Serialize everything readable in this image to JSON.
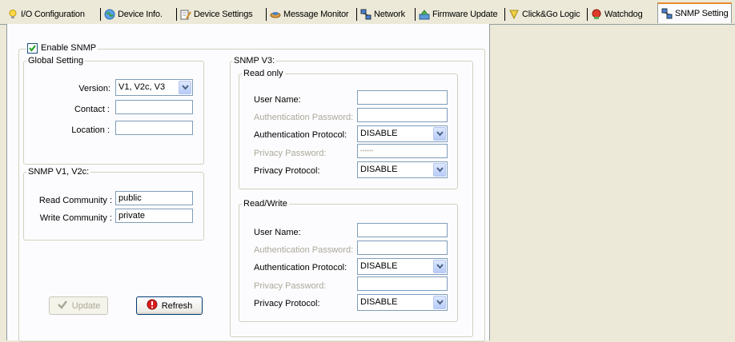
{
  "tabs": [
    {
      "label": "I/O Configuration",
      "icon": "lightbulb-icon"
    },
    {
      "label": "Device Info.",
      "icon": "globe-icon"
    },
    {
      "label": "Device Settings",
      "icon": "device-settings-icon"
    },
    {
      "label": "Message Monitor",
      "icon": "message-icon"
    },
    {
      "label": "Network",
      "icon": "network-icon"
    },
    {
      "label": "Firmware Update",
      "icon": "firmware-icon"
    },
    {
      "label": "Click&Go Logic",
      "icon": "logic-icon"
    },
    {
      "label": "Watchdog",
      "icon": "watchdog-icon"
    },
    {
      "label": "SNMP Setting",
      "icon": "snmp-icon"
    }
  ],
  "active_tab": "SNMP Setting",
  "enable_snmp": {
    "label": "Enable SNMP",
    "checked": true
  },
  "global": {
    "legend": "Global Setting",
    "version_label": "Version:",
    "version_value": "V1, V2c, V3",
    "contact_label": "Contact :",
    "contact_value": "",
    "location_label": "Location :",
    "location_value": ""
  },
  "v1v2c": {
    "legend": "SNMP V1, V2c:",
    "read_label": "Read Community :",
    "read_value": "public",
    "write_label": "Write Community :",
    "write_value": "private"
  },
  "v3": {
    "legend": "SNMP V3:",
    "read_only": {
      "legend": "Read only",
      "user_label": "User Name:",
      "user_value": "",
      "auth_pw_label": "Authentication Password:",
      "auth_pw_value": "",
      "auth_proto_label": "Authentication Protocol:",
      "auth_proto_value": "DISABLE",
      "priv_pw_label": "Privacy Password:",
      "priv_pw_value": "******",
      "priv_proto_label": "Privacy Protocol:",
      "priv_proto_value": "DISABLE"
    },
    "read_write": {
      "legend": "Read/Write",
      "user_label": "User Name:",
      "user_value": "",
      "auth_pw_label": "Authentication Password:",
      "auth_pw_value": "",
      "auth_proto_label": "Authentication Protocol:",
      "auth_proto_value": "DISABLE",
      "priv_pw_label": "Privacy Password:",
      "priv_pw_value": "",
      "priv_proto_label": "Privacy Protocol:",
      "priv_proto_value": "DISABLE"
    }
  },
  "buttons": {
    "update_label": "Update",
    "refresh_label": "Refresh"
  },
  "colors": {
    "accent_tab": "#e68b2c",
    "panel_bg": "#fcfcfe",
    "window_bg": "#ece9d8"
  }
}
